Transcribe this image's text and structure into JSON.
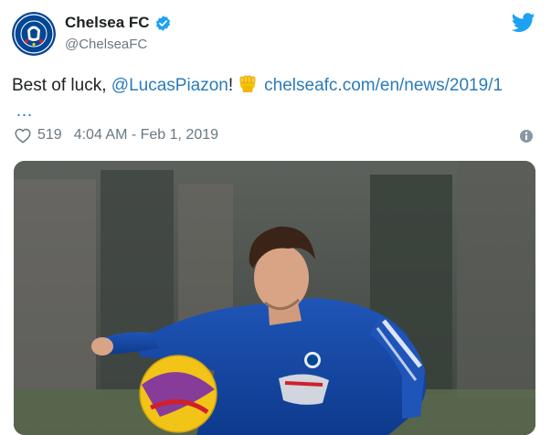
{
  "tweet": {
    "author": {
      "display_name": "Chelsea FC",
      "handle": "@ChelseaFC",
      "avatar_icon": "chelsea-crest-icon",
      "verified_icon": "verified-badge-icon"
    },
    "text": {
      "prefix": "Best of luck, ",
      "mention": "@LucasPiazon",
      "suffix": "!",
      "emoji_icon": "raised-fist-emoji",
      "link": "chelseafc.com/en/news/2019/1",
      "ellipsis": "…"
    },
    "meta": {
      "likes": "519",
      "timestamp": "4:04 AM - Feb 1, 2019",
      "heart_icon": "heart-icon",
      "info_icon": "info-icon"
    },
    "media": {
      "photo": "player-training-photo"
    }
  },
  "brand": {
    "twitter_icon": "twitter-bird-icon",
    "twitter_color": "#1da1f2",
    "link_color": "#2b7bb9",
    "chelsea_blue": "#034694"
  }
}
